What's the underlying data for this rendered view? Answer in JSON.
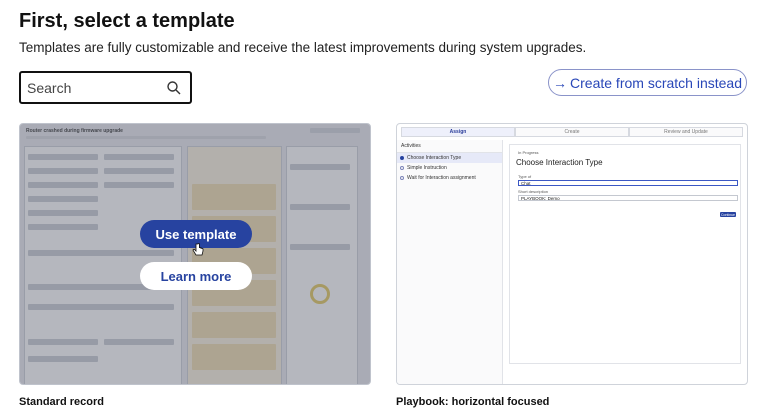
{
  "header": {
    "title": "First, select a template",
    "subtitle": "Templates are fully customizable and receive the latest improvements during system upgrades."
  },
  "search": {
    "placeholder": "Search",
    "value": ""
  },
  "actions": {
    "create_scratch_label": "Create from scratch instead"
  },
  "templates": [
    {
      "name": "Standard record",
      "use_label": "Use template",
      "learn_label": "Learn more",
      "preview": {
        "heading": "Router crashed during firmware upgrade"
      }
    },
    {
      "name": "Playbook: horizontal focused",
      "preview": {
        "steps": [
          "Assign",
          "Create",
          "Review and Update"
        ],
        "sidebar_title": "Activities",
        "sidebar_items": [
          "Choose Interaction Type",
          "Simple Instruction",
          "Wait for Interaction assignment"
        ],
        "status": "In Progress",
        "heading": "Choose Interaction Type",
        "type_label": "Type of",
        "type_value": "Chat",
        "desc_label": "Short description",
        "desc_value": "PLAYBOOK: Demo",
        "continue_label": "Continue"
      }
    }
  ],
  "colors": {
    "accent": "#2743a0",
    "link": "#2947b8"
  }
}
